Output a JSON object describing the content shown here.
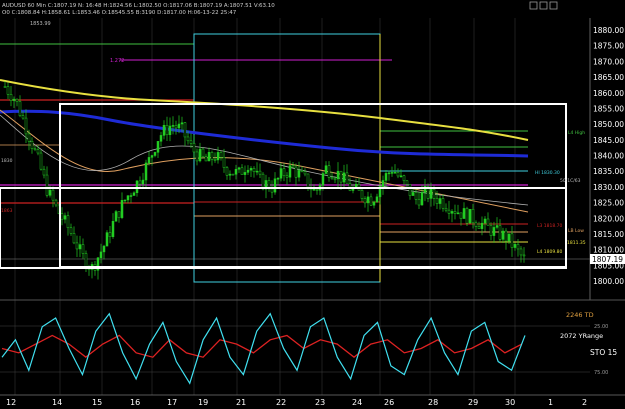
{
  "header": {
    "line1": "AUDUSD 60 Min  C:1807.19  N:  16:48  H:1824.56  L:1802.50  O:1817.06  B:1807.19  A:1807.51  V:63.10",
    "line2": "O0  C:1808.84  H:1858.61  L:1853.46  O:18545.55  B:3190  D:1817.00  H:06-13-22  25:47",
    "ref_price": "1853.99"
  },
  "price_axis": {
    "labels": [
      "1880.00",
      "1875.00",
      "1870.00",
      "1865.00",
      "1860.00",
      "1855.00",
      "1850.00",
      "1845.00",
      "1840.00",
      "1835.00",
      "1830.00",
      "1825.00",
      "1820.00",
      "1815.00",
      "1810.00",
      "1805.00",
      "1800.00"
    ],
    "current_price": "1807.19"
  },
  "time_axis": {
    "labels": [
      "12",
      "14",
      "15",
      "16",
      "17",
      "19",
      "21",
      "22",
      "23",
      "24",
      "26",
      "28",
      "29",
      "30",
      "1",
      "2"
    ]
  },
  "annotations": {
    "level_1": "1.272",
    "mid_label": "HI 1830.30",
    "mid_right": "50:1C/63",
    "lower_1": "L3 1818.70",
    "lower_2": "L4 1809.80",
    "lower_3": "1811.35",
    "right_tag_1": "L4 High",
    "right_tag_2": "LB Low",
    "left_tag_1": "1830",
    "left_tag_2": "1863"
  },
  "oscillator": {
    "label_td": "2246 TD",
    "label_range": "2072 YRange",
    "label_sto": "STO  15",
    "level_high": "25.00",
    "level_low": "75.00"
  },
  "colors": {
    "background": "#000000",
    "candles": "#22cc22",
    "ma_blue": "#1e2bd6",
    "ma_yellow": "#e8e040",
    "ma_orange": "#e0a060",
    "level_red": "#cc2222",
    "level_magenta": "#d020d0",
    "level_cyan": "#40d0e0",
    "level_green": "#40c040",
    "osc_cyan": "#40e0f0",
    "osc_red": "#dd2222",
    "box": "#ffffff"
  },
  "chart_data": {
    "type": "candlestick",
    "price_axis_values": [
      1880,
      1875,
      1870,
      1865,
      1860,
      1855,
      1850,
      1845,
      1840,
      1835,
      1830,
      1825,
      1820,
      1815,
      1810,
      1805,
      1800
    ],
    "current_price": 1807.19,
    "close_path": [
      [
        0,
        1862
      ],
      [
        0.3,
        1858
      ],
      [
        0.6,
        1850
      ],
      [
        1.0,
        1838
      ],
      [
        1.3,
        1828
      ],
      [
        1.6,
        1822
      ],
      [
        2.0,
        1815
      ],
      [
        2.3,
        1808
      ],
      [
        2.6,
        1804
      ],
      [
        3.0,
        1812
      ],
      [
        3.3,
        1820
      ],
      [
        3.6,
        1826
      ],
      [
        4.0,
        1832
      ],
      [
        4.3,
        1838
      ],
      [
        4.6,
        1846
      ],
      [
        5.0,
        1850
      ],
      [
        5.3,
        1848
      ],
      [
        5.6,
        1842
      ],
      [
        6.0,
        1838
      ],
      [
        6.3,
        1840
      ],
      [
        6.6,
        1836
      ],
      [
        7.0,
        1834
      ],
      [
        7.3,
        1838
      ],
      [
        7.6,
        1832
      ],
      [
        8.0,
        1830
      ],
      [
        8.3,
        1834
      ],
      [
        8.6,
        1836
      ],
      [
        9.0,
        1832
      ],
      [
        9.3,
        1828
      ],
      [
        9.6,
        1836
      ],
      [
        10.0,
        1834
      ],
      [
        10.3,
        1830
      ],
      [
        10.6,
        1828
      ],
      [
        11.0,
        1826
      ],
      [
        11.3,
        1832
      ],
      [
        11.6,
        1836
      ],
      [
        12.0,
        1830
      ],
      [
        12.3,
        1826
      ],
      [
        12.6,
        1828
      ],
      [
        13.0,
        1826
      ],
      [
        13.3,
        1824
      ],
      [
        13.6,
        1822
      ],
      [
        14.0,
        1820
      ],
      [
        14.3,
        1818
      ],
      [
        14.6,
        1816
      ],
      [
        15.0,
        1814
      ],
      [
        15.3,
        1810
      ],
      [
        15.6,
        1806
      ]
    ],
    "oscillator_cyan": [
      [
        0,
        40
      ],
      [
        0.4,
        60
      ],
      [
        0.8,
        25
      ],
      [
        1.2,
        75
      ],
      [
        1.6,
        85
      ],
      [
        2.0,
        50
      ],
      [
        2.4,
        20
      ],
      [
        2.8,
        70
      ],
      [
        3.2,
        90
      ],
      [
        3.6,
        45
      ],
      [
        4.0,
        15
      ],
      [
        4.4,
        55
      ],
      [
        4.8,
        80
      ],
      [
        5.2,
        35
      ],
      [
        5.6,
        10
      ],
      [
        6.0,
        60
      ],
      [
        6.4,
        85
      ],
      [
        6.8,
        40
      ],
      [
        7.2,
        20
      ],
      [
        7.6,
        70
      ],
      [
        8.0,
        90
      ],
      [
        8.4,
        50
      ],
      [
        8.8,
        25
      ],
      [
        9.2,
        75
      ],
      [
        9.6,
        85
      ],
      [
        10.0,
        40
      ],
      [
        10.4,
        15
      ],
      [
        10.8,
        65
      ],
      [
        11.2,
        80
      ],
      [
        11.6,
        30
      ],
      [
        12.0,
        20
      ],
      [
        12.4,
        60
      ],
      [
        12.8,
        85
      ],
      [
        13.2,
        45
      ],
      [
        13.6,
        20
      ],
      [
        14.0,
        70
      ],
      [
        14.4,
        80
      ],
      [
        14.8,
        35
      ],
      [
        15.2,
        25
      ],
      [
        15.6,
        65
      ]
    ],
    "oscillator_red": [
      [
        0,
        50
      ],
      [
        0.5,
        45
      ],
      [
        1.0,
        55
      ],
      [
        1.5,
        65
      ],
      [
        2.0,
        55
      ],
      [
        2.5,
        40
      ],
      [
        3.0,
        55
      ],
      [
        3.5,
        65
      ],
      [
        4.0,
        45
      ],
      [
        4.5,
        40
      ],
      [
        5.0,
        60
      ],
      [
        5.5,
        45
      ],
      [
        6.0,
        40
      ],
      [
        6.5,
        60
      ],
      [
        7.0,
        55
      ],
      [
        7.5,
        45
      ],
      [
        8.0,
        60
      ],
      [
        8.5,
        65
      ],
      [
        9.0,
        50
      ],
      [
        9.5,
        60
      ],
      [
        10.0,
        55
      ],
      [
        10.5,
        40
      ],
      [
        11.0,
        55
      ],
      [
        11.5,
        60
      ],
      [
        12.0,
        45
      ],
      [
        12.5,
        50
      ],
      [
        13.0,
        60
      ],
      [
        13.5,
        45
      ],
      [
        14.0,
        50
      ],
      [
        14.5,
        60
      ],
      [
        15.0,
        45
      ],
      [
        15.5,
        55
      ]
    ]
  }
}
